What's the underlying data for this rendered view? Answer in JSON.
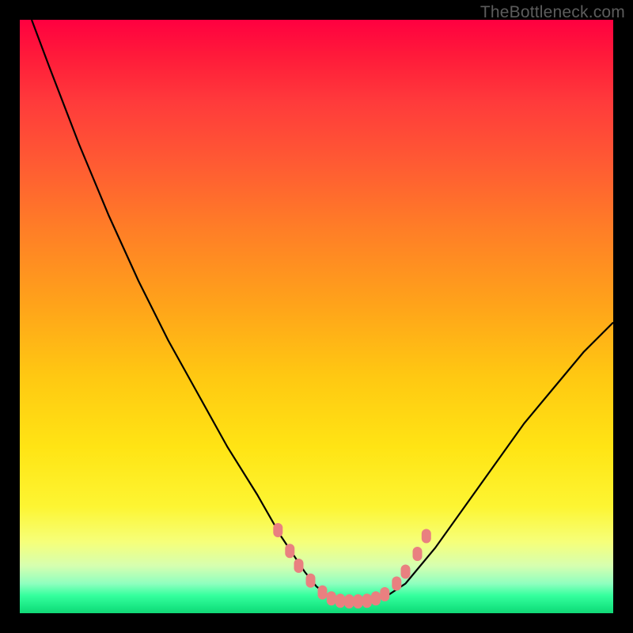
{
  "watermark": "TheBottleneck.com",
  "colors": {
    "background": "#000000",
    "gradient_top": "#ff0040",
    "gradient_mid1": "#ff7d27",
    "gradient_mid2": "#ffe414",
    "gradient_bottom": "#12d877",
    "curve": "#000000",
    "marker": "#e98080"
  },
  "chart_data": {
    "type": "line",
    "title": "",
    "xlabel": "",
    "ylabel": "",
    "xlim": [
      0,
      100
    ],
    "ylim": [
      0,
      100
    ],
    "grid": false,
    "legend": false,
    "series": [
      {
        "name": "bottleneck-curve",
        "x": [
          2,
          5,
          10,
          15,
          20,
          25,
          30,
          35,
          40,
          44,
          46,
          48,
          50,
          52,
          54,
          56,
          58,
          60,
          62,
          65,
          70,
          75,
          80,
          85,
          90,
          95,
          100
        ],
        "y": [
          100,
          92,
          79,
          67,
          56,
          46,
          37,
          28,
          20,
          13,
          10,
          7,
          4.5,
          3,
          2.3,
          2,
          2,
          2.3,
          3,
          5,
          11,
          18,
          25,
          32,
          38,
          44,
          49
        ]
      }
    ],
    "markers": [
      {
        "x": 43.5,
        "y": 14
      },
      {
        "x": 45.5,
        "y": 10.5
      },
      {
        "x": 47,
        "y": 8
      },
      {
        "x": 49,
        "y": 5.5
      },
      {
        "x": 51,
        "y": 3.5
      },
      {
        "x": 52.5,
        "y": 2.5
      },
      {
        "x": 54,
        "y": 2.1
      },
      {
        "x": 55.5,
        "y": 2.0
      },
      {
        "x": 57,
        "y": 2.0
      },
      {
        "x": 58.5,
        "y": 2.1
      },
      {
        "x": 60,
        "y": 2.5
      },
      {
        "x": 61.5,
        "y": 3.2
      },
      {
        "x": 63.5,
        "y": 5
      },
      {
        "x": 65,
        "y": 7
      },
      {
        "x": 67,
        "y": 10
      },
      {
        "x": 68.5,
        "y": 13
      }
    ]
  }
}
